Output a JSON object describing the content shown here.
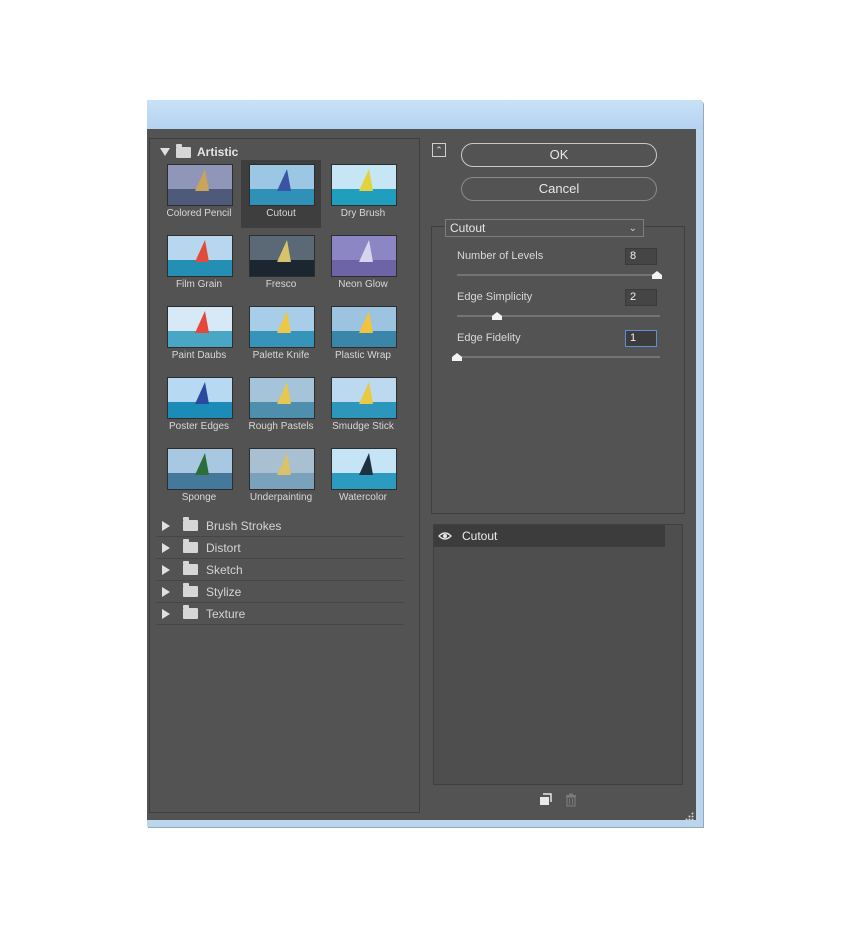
{
  "filter_gallery": {
    "category_open": {
      "name": "Artistic",
      "filters": [
        {
          "label": "Colored Pencil",
          "selected": false,
          "sky": "#8f96b8",
          "sea": "#4d5a7a",
          "sail": "#c9a45a"
        },
        {
          "label": "Cutout",
          "selected": true,
          "sky": "#9bc6e4",
          "sea": "#2f90b8",
          "sail": "#3a54a4"
        },
        {
          "label": "Dry Brush",
          "selected": false,
          "sky": "#c6e6f6",
          "sea": "#1f9fbd",
          "sail": "#e2d23c"
        },
        {
          "label": "Film Grain",
          "selected": false,
          "sky": "#b8d6ee",
          "sea": "#238fb2",
          "sail": "#e14b3c"
        },
        {
          "label": "Fresco",
          "selected": false,
          "sky": "#5b6977",
          "sea": "#1b2630",
          "sail": "#d6c36a"
        },
        {
          "label": "Neon Glow",
          "selected": false,
          "sky": "#8d86c4",
          "sea": "#6d64a8",
          "sail": "#d8d4f0"
        },
        {
          "label": "Paint Daubs",
          "selected": false,
          "sky": "#d7e8f6",
          "sea": "#49a6c5",
          "sail": "#e64739"
        },
        {
          "label": "Palette Knife",
          "selected": false,
          "sky": "#a8cde8",
          "sea": "#3594b8",
          "sail": "#edc845"
        },
        {
          "label": "Plastic Wrap",
          "selected": false,
          "sky": "#9cc3df",
          "sea": "#3a86a8",
          "sail": "#f0c43e"
        },
        {
          "label": "Poster Edges",
          "selected": false,
          "sky": "#b7d9f2",
          "sea": "#1b8cb7",
          "sail": "#2a4aa0"
        },
        {
          "label": "Rough Pastels",
          "selected": false,
          "sky": "#a5c3d9",
          "sea": "#4e8fad",
          "sail": "#e5c850"
        },
        {
          "label": "Smudge Stick",
          "selected": false,
          "sky": "#bcd9ef",
          "sea": "#2c97bb",
          "sail": "#e8ca42"
        },
        {
          "label": "Sponge",
          "selected": false,
          "sky": "#a8c7e0",
          "sea": "#45799c",
          "sail": "#2c6e3a"
        },
        {
          "label": "Underpainting",
          "selected": false,
          "sky": "#a9bfd2",
          "sea": "#7aa2bd",
          "sail": "#d9c26a"
        },
        {
          "label": "Watercolor",
          "selected": false,
          "sky": "#c5e4f6",
          "sea": "#2b9bc0",
          "sail": "#1e3140"
        }
      ]
    },
    "categories_closed": [
      "Brush Strokes",
      "Distort",
      "Sketch",
      "Stylize",
      "Texture"
    ]
  },
  "buttons": {
    "ok": "OK",
    "cancel": "Cancel"
  },
  "filter_select": {
    "value": "Cutout"
  },
  "params": [
    {
      "label": "Number of Levels",
      "value": "8",
      "position": 1.0,
      "focused": false
    },
    {
      "label": "Edge Simplicity",
      "value": "2",
      "position": 0.2,
      "focused": false
    },
    {
      "label": "Edge Fidelity",
      "value": "1",
      "position": 0.0,
      "focused": true
    }
  ],
  "effect_layers": [
    {
      "label": "Cutout",
      "icon": "eye-icon"
    }
  ],
  "bottom_icons": [
    "new-layer-icon",
    "delete-layer-icon"
  ],
  "colors": {
    "panel_bg": "#535353",
    "title_bar": "#b4d3f1",
    "selection": "#3e3e3e",
    "focus_border": "#5d8ed6"
  }
}
